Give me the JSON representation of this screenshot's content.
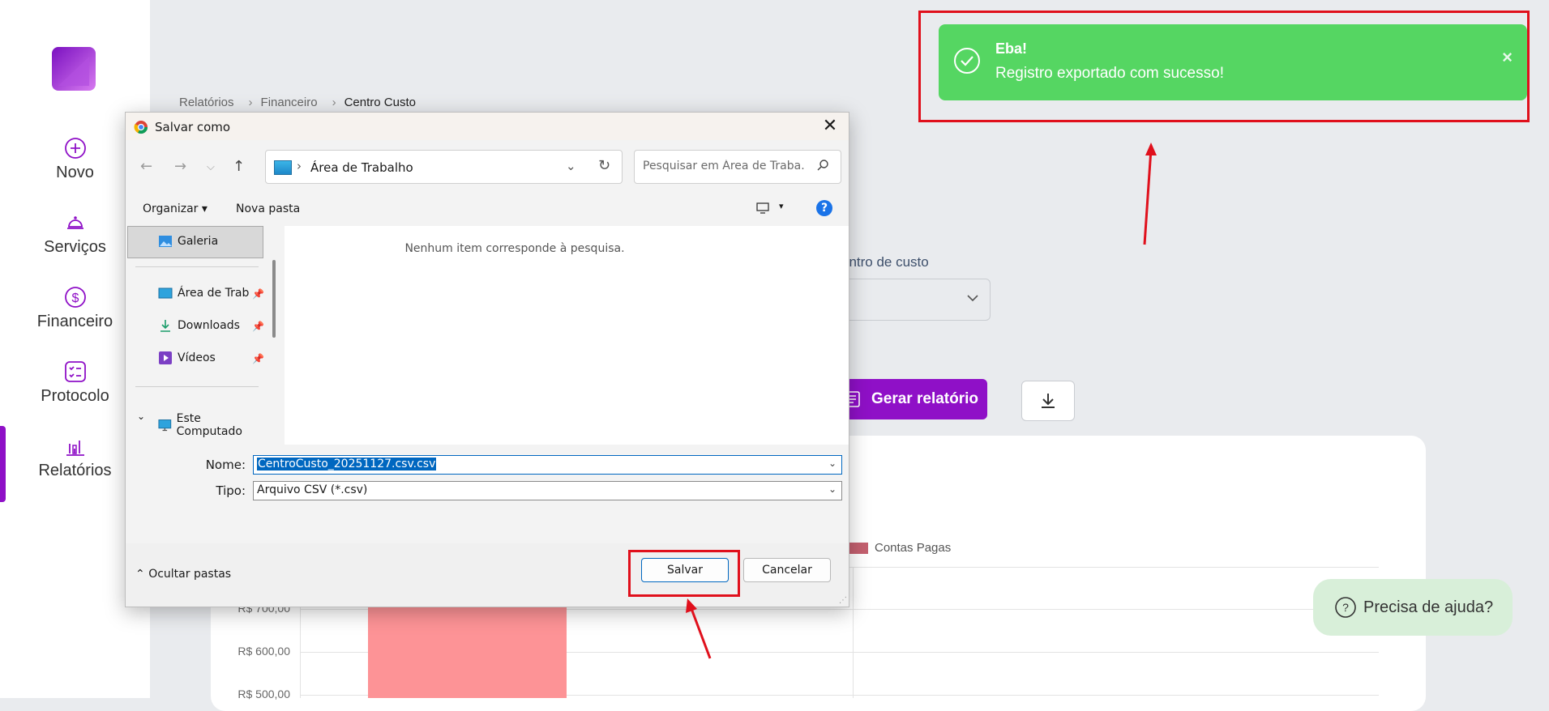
{
  "sidebar": {
    "items": [
      {
        "label": "Novo",
        "icon": "plus-circle-icon"
      },
      {
        "label": "Serviços",
        "icon": "bell-service-icon"
      },
      {
        "label": "Financeiro",
        "icon": "dollar-circle-icon"
      },
      {
        "label": "Protocolo",
        "icon": "checklist-icon"
      },
      {
        "label": "Relatórios",
        "icon": "bar-chart-icon"
      }
    ],
    "active": "Relatórios",
    "accent": "#8f10c7"
  },
  "breadcrumb": [
    "Relatórios",
    "Financeiro",
    "Centro Custo"
  ],
  "filter": {
    "label": "entro de custo"
  },
  "actions": {
    "generate_label": "Gerar relatório"
  },
  "chart_data": {
    "type": "bar",
    "series": [
      {
        "name": "Contas Pagas",
        "color": "#c4606f"
      }
    ],
    "y_ticks": [
      "R$ 700,00",
      "R$ 600,00",
      "R$ 500,00"
    ]
  },
  "toast": {
    "title": "Eba!",
    "message": "Registro exportado com sucesso!",
    "close": "×",
    "color": "#55d662"
  },
  "help": {
    "label": "Precisa de ajuda?"
  },
  "dialog": {
    "title": "Salvar como",
    "close": "✕",
    "address": "Área de Trabalho",
    "search_placeholder": "Pesquisar em Área de Traba...",
    "organize": "Organizar ▾",
    "new_folder": "Nova pasta",
    "tree": {
      "selected": "Galeria",
      "quick": [
        "Área de Trab",
        "Downloads",
        "Vídeos"
      ],
      "computer": "Este Computado"
    },
    "empty_message": "Nenhum item corresponde à pesquisa.",
    "name_label": "Nome:",
    "name_value": "CentroCusto_20251127.csv.csv",
    "type_label": "Tipo:",
    "type_value": "Arquivo CSV (*.csv)",
    "hide_folders": "Ocultar pastas",
    "save": "Salvar",
    "cancel": "Cancelar"
  }
}
